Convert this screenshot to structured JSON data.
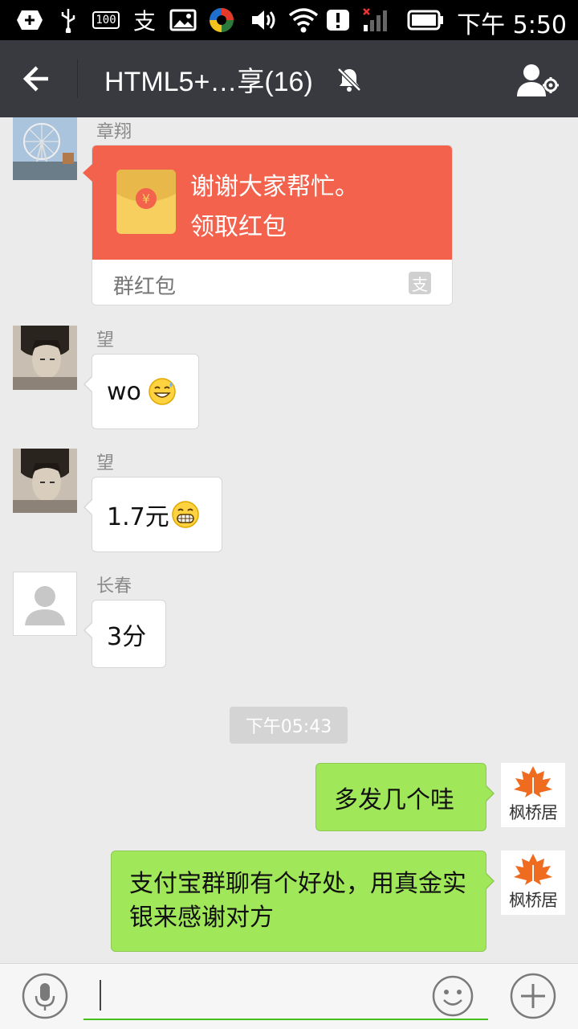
{
  "status_bar": {
    "time": "下午 5:50",
    "icons": [
      "add-notification-icon",
      "usb-icon",
      "battery-100-badge-icon",
      "alipay-icon",
      "image-icon",
      "app-icon",
      "volume-icon",
      "wifi-icon",
      "alert-icon",
      "signal-icon",
      "battery-icon"
    ],
    "badge_100": "100",
    "alipay_glyph": "支"
  },
  "header": {
    "title": "HTML5+…享(16)",
    "mute_icon": "mute-bell-icon",
    "right_icon": "group-settings-icon"
  },
  "messages": [
    {
      "sender": "章翔",
      "type": "red_packet",
      "line1": "谢谢大家帮忙。",
      "line2": "领取红包",
      "footer_label": "群红包",
      "footer_logo": "支"
    },
    {
      "sender": "望",
      "type": "text",
      "text": "wo",
      "emoji": "sweat-smile-emoji"
    },
    {
      "sender": "望",
      "type": "text",
      "text": "1.7元",
      "emoji": "grin-emoji"
    },
    {
      "sender": "长春",
      "type": "text",
      "text": "3分"
    },
    {
      "type": "time",
      "text": "下午05:43"
    },
    {
      "from_me": true,
      "type": "text",
      "text": "多发几个哇",
      "avatar_label": "枫桥居"
    },
    {
      "from_me": true,
      "type": "text",
      "text": "支付宝群聊有个好处，用真金实银来感谢对方",
      "avatar_label": "枫桥居"
    }
  ],
  "input_bar": {
    "voice_icon": "microphone-icon",
    "emoji_icon": "smiley-icon",
    "plus_icon": "plus-icon",
    "value": ""
  },
  "colors": {
    "title_bar": "#393a3f",
    "red_packet": "#f2624d",
    "my_bubble": "#a0e75a",
    "accent_line": "#45c01a"
  }
}
